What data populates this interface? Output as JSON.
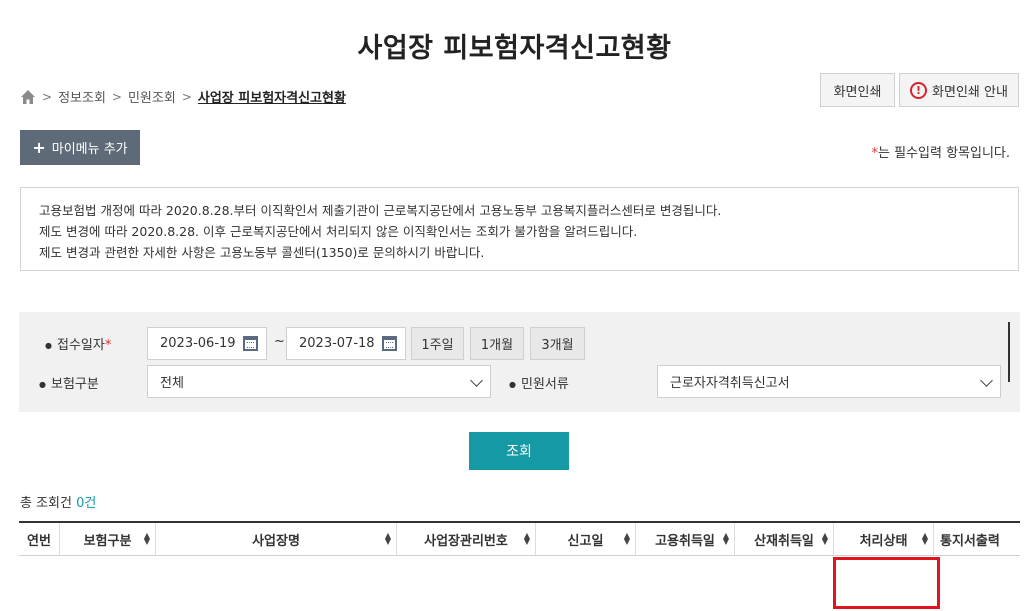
{
  "header": {
    "title": "사업장 피보험자격신고현황"
  },
  "breadcrumb": {
    "items": [
      "정보조회",
      "민원조회"
    ],
    "current": "사업장 피보험자격신고현황"
  },
  "buttons": {
    "print": "화면인쇄",
    "print_guide": "화면인쇄 안내",
    "mymenu": "마이메뉴 추가",
    "search": "조회"
  },
  "required_note": {
    "star": "*",
    "text": "는 필수입력 항목입니다."
  },
  "notice": {
    "lines": [
      "고용보험법 개정에 따라 2020.8.28.부터 이직확인서 제출기관이 근로복지공단에서 고용노동부 고용복지플러스센터로 변경됩니다.",
      "제도 변경에 따라 2020.8.28. 이후 근로복지공단에서 처리되지 않은 이직확인서는 조회가 불가함을 알려드립니다.",
      "제도 변경과 관련한 자세한 사항은 고용노동부 콜센터(1350)로 문의하시기 바랍니다."
    ]
  },
  "search": {
    "date_label": "접수일자",
    "date_required": "*",
    "date_from": "2023-06-19",
    "tilde": "~",
    "date_to": "2023-07-18",
    "periods": [
      "1주일",
      "1개월",
      "3개월"
    ],
    "insurance_label": "보험구분",
    "insurance_value": "전체",
    "doc_label": "민원서류",
    "doc_value": "근로자자격취득신고서"
  },
  "result": {
    "total_label": "총 조회건",
    "total_count": "0건"
  },
  "table": {
    "columns": [
      "연번",
      "보험구분",
      "사업장명",
      "사업장관리번호",
      "신고일",
      "고용취득일",
      "산재취득일",
      "처리상태",
      "통지서출력"
    ]
  },
  "colors": {
    "accent": "#159aa5",
    "mymenu_bg": "#5e6a78",
    "highlight": "#e0141e",
    "required": "#e03030"
  }
}
